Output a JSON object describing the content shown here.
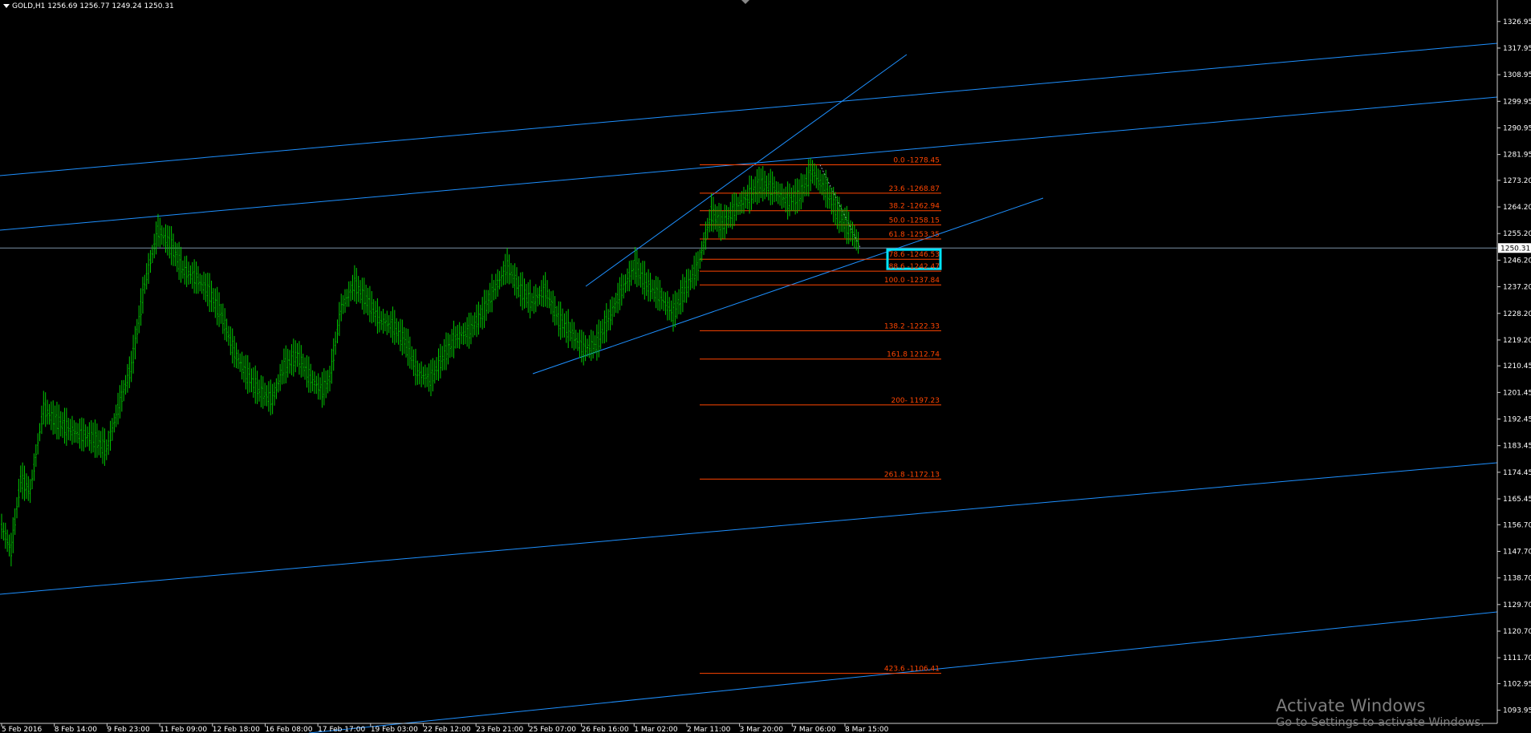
{
  "header": {
    "symbol": "GOLD,H1",
    "open": "1256.69",
    "high": "1256.77",
    "low": "1249.24",
    "close": "1250.31"
  },
  "watermark": {
    "line1": "Activate Windows",
    "line2": "Go to Settings to activate Windows."
  },
  "colors": {
    "background": "#000000",
    "candle": "#00c800",
    "trendline": "#1e90ff",
    "fibo": "#ff4500",
    "highlight_box": "#00e5ff",
    "axis_text": "#ffffff"
  },
  "chart_data": {
    "type": "line",
    "title": "",
    "xlabel": "",
    "ylabel": "",
    "ylim": [
      1089.5,
      1331.5
    ],
    "grid": false,
    "current_price": "1250.31",
    "y_ticks": [
      "1326.95",
      "1317.95",
      "1308.95",
      "1299.95",
      "1290.95",
      "1281.95",
      "1273.20",
      "1264.20",
      "1255.20",
      "1246.20",
      "1237.20",
      "1228.20",
      "1219.20",
      "1210.45",
      "1201.45",
      "1192.45",
      "1183.45",
      "1174.45",
      "1165.45",
      "1156.70",
      "1147.70",
      "1138.70",
      "1129.70",
      "1120.70",
      "1111.70",
      "1102.95",
      "1093.95"
    ],
    "x_ticks": [
      "5 Feb 2016",
      "8 Feb 14:00",
      "9 Feb 23:00",
      "11 Feb 09:00",
      "12 Feb 18:00",
      "16 Feb 08:00",
      "17 Feb 17:00",
      "19 Feb 03:00",
      "22 Feb 12:00",
      "23 Feb 21:00",
      "25 Feb 07:00",
      "26 Feb 16:00",
      "1 Mar 02:00",
      "2 Mar 11:00",
      "3 Mar 20:00",
      "7 Mar 06:00",
      "8 Mar 15:00"
    ],
    "x": [
      0,
      5,
      10,
      15,
      22,
      28,
      35,
      42,
      48,
      55,
      62,
      68,
      75,
      82,
      88,
      95,
      102,
      108,
      115,
      122,
      128,
      135,
      142,
      148,
      155,
      162,
      168,
      172,
      178,
      185,
      192,
      198,
      205,
      212,
      218,
      225,
      232,
      238,
      245,
      252,
      258,
      265,
      272,
      278,
      285,
      292,
      298,
      305,
      312,
      318,
      325,
      332,
      338,
      345,
      352,
      358,
      365,
      372,
      378,
      385,
      392,
      398,
      405,
      412,
      418,
      425,
      432,
      438,
      445,
      450
    ],
    "series": [
      {
        "values": [
          1156,
          1148,
          1172,
          1168,
          1196,
          1192,
          1189,
          1187,
          1186,
          1182,
          1198,
          1210,
          1238,
          1256,
          1252,
          1243,
          1240,
          1236,
          1228,
          1215,
          1208,
          1202,
          1199,
          1210,
          1214,
          1206,
          1202,
          1206,
          1230,
          1238,
          1232,
          1226,
          1224,
          1218,
          1208,
          1206,
          1214,
          1220,
          1222,
          1228,
          1236,
          1244,
          1236,
          1232,
          1236,
          1226,
          1222,
          1216,
          1218,
          1226,
          1236,
          1244,
          1238,
          1234,
          1228,
          1236,
          1244,
          1262,
          1258,
          1264,
          1268,
          1272,
          1270,
          1266,
          1268,
          1276,
          1270,
          1262,
          1256,
          1251
        ]
      }
    ],
    "fibonacci": [
      {
        "label": "0.0 -1278.45",
        "level": 1278.45
      },
      {
        "label": "23.6 -1268.87",
        "level": 1268.87
      },
      {
        "label": "38.2 -1262.94",
        "level": 1262.94
      },
      {
        "label": "50.0 -1258.15",
        "level": 1258.15
      },
      {
        "label": "61.8 -1253.35",
        "level": 1253.35
      },
      {
        "label": "78.6 -1246.53",
        "level": 1246.53
      },
      {
        "label": "88.6 -1242.47",
        "level": 1242.47
      },
      {
        "label": "100.0 -1237.84",
        "level": 1237.84
      },
      {
        "label": "138.2 -1222.33",
        "level": 1222.33
      },
      {
        "label": "161.8 1212.74",
        "level": 1212.74
      },
      {
        "label": "200- 1197.23",
        "level": 1197.23
      },
      {
        "label": "261.8 -1172.13",
        "level": 1172.13
      },
      {
        "label": "423.6 -1106.41",
        "level": 1106.41
      }
    ],
    "highlighted_fibo": "78.6 -1246.53"
  }
}
